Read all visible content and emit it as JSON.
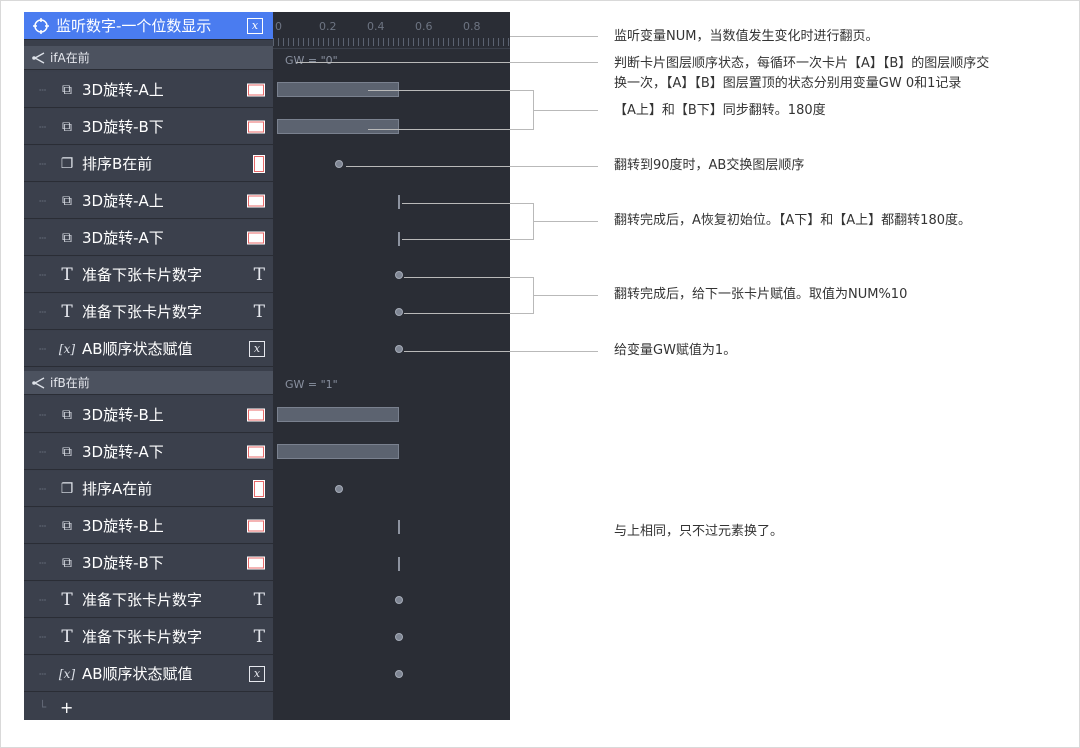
{
  "panel": {
    "header": {
      "title": "监听数字-一个位数显示",
      "icon": "target-icon"
    },
    "groups": [
      {
        "condition": "ifA在前",
        "gw": "GW = \"0\"",
        "items": [
          {
            "label": "3D旋转-A上",
            "type": "3d-rotate"
          },
          {
            "label": "3D旋转-B下",
            "type": "3d-rotate"
          },
          {
            "label": "排序B在前",
            "type": "order"
          },
          {
            "label": "3D旋转-A上",
            "type": "3d-rotate"
          },
          {
            "label": "3D旋转-A下",
            "type": "3d-rotate"
          },
          {
            "label": "准备下张卡片数字",
            "type": "text"
          },
          {
            "label": "准备下张卡片数字",
            "type": "text"
          },
          {
            "label": "AB顺序状态赋值",
            "type": "variable"
          }
        ]
      },
      {
        "condition": "ifB在前",
        "gw": "GW = \"1\"",
        "items": [
          {
            "label": "3D旋转-B上",
            "type": "3d-rotate"
          },
          {
            "label": "3D旋转-A下",
            "type": "3d-rotate"
          },
          {
            "label": "排序A在前",
            "type": "order"
          },
          {
            "label": "3D旋转-B上",
            "type": "3d-rotate"
          },
          {
            "label": "3D旋转-B下",
            "type": "3d-rotate"
          },
          {
            "label": "准备下张卡片数字",
            "type": "text"
          },
          {
            "label": "准备下张卡片数字",
            "type": "text"
          },
          {
            "label": "AB顺序状态赋值",
            "type": "variable"
          }
        ]
      }
    ],
    "add_label": "+",
    "ruler_labels": [
      "0",
      "0.2",
      "0.4",
      "0.6",
      "0.8"
    ]
  },
  "notes": {
    "n1": "监听变量NUM，当数值发生变化时进行翻页。",
    "n2a": "判断卡片图层顺序状态，每循环一次卡片【A】【B】的图层顺序交",
    "n2b": "换一次，【A】【B】图层置顶的状态分别用变量GW 0和1记录",
    "n3": "【A上】和【B下】同步翻转。180度",
    "n4": "翻转到90度时，AB交换图层顺序",
    "n5": "翻转完成后，A恢复初始位。【A下】和【A上】都翻转180度。",
    "n6": "翻转完成后，给下一张卡片赋值。取值为NUM%10",
    "n7": "给变量GW赋值为1。",
    "n8": "与上相同，只不过元素换了。"
  }
}
